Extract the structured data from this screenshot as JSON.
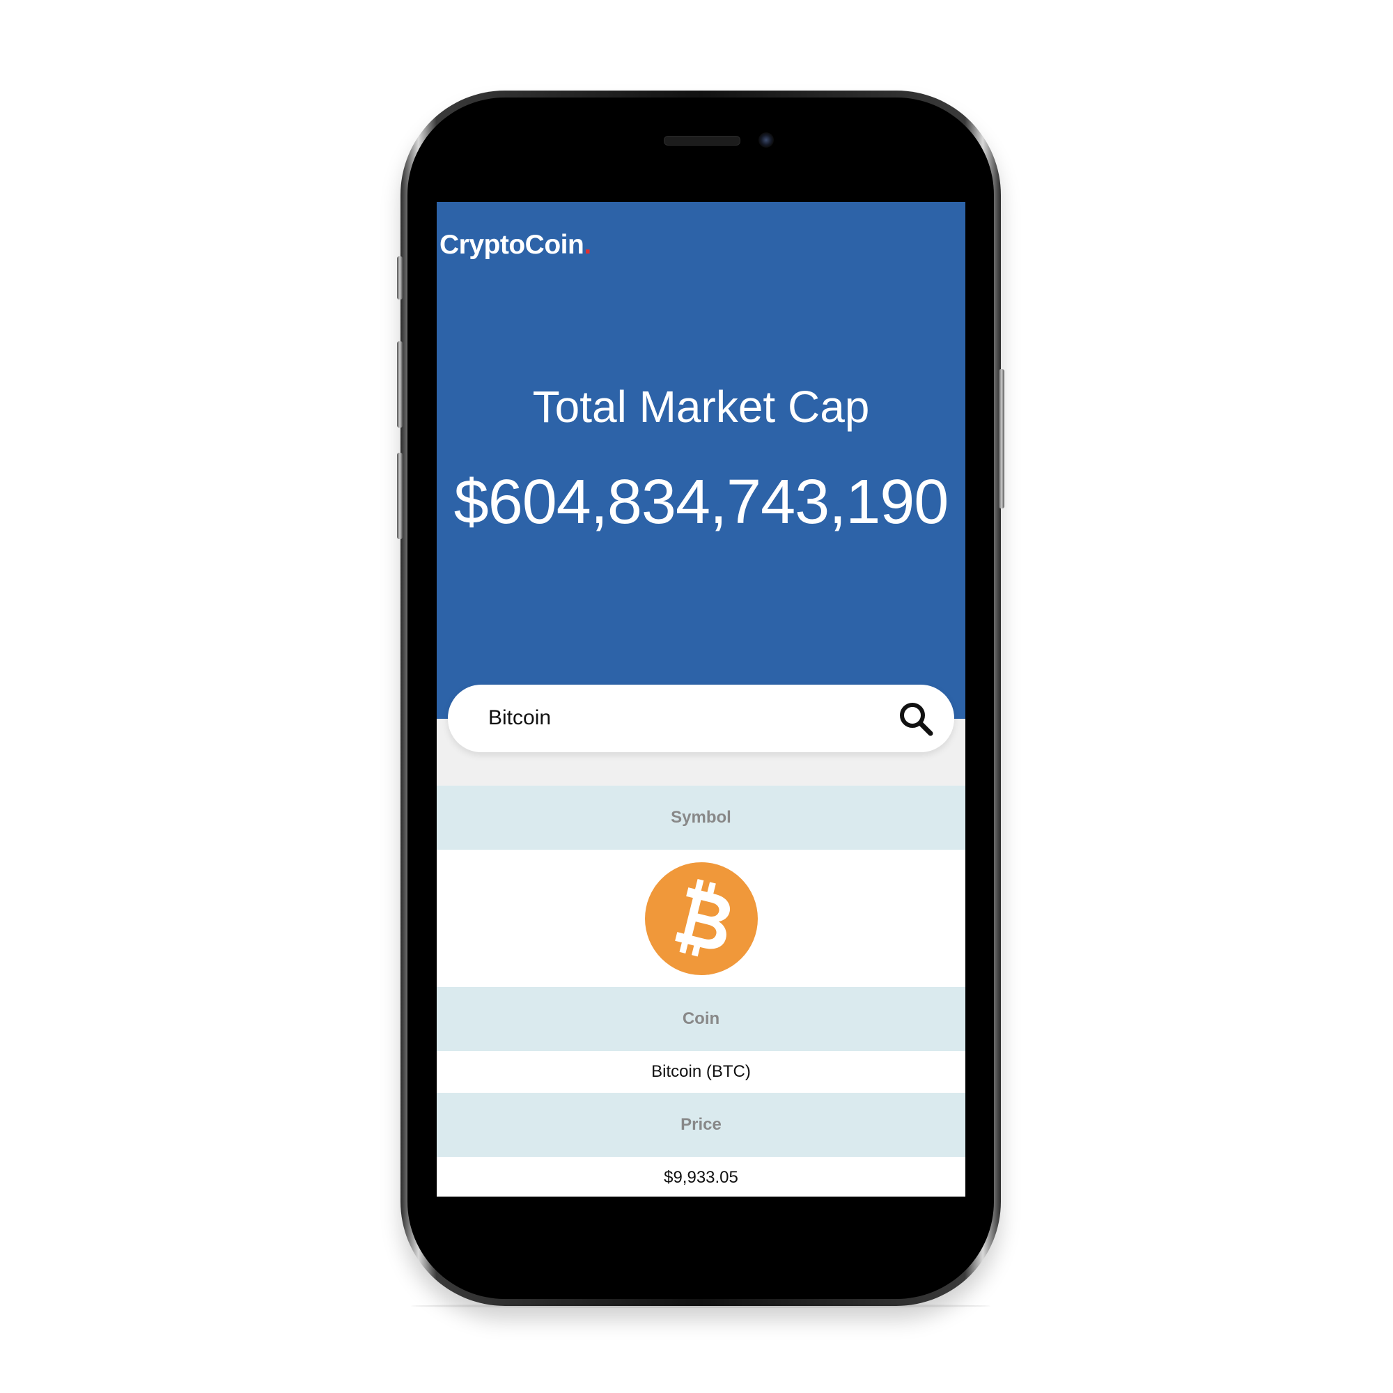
{
  "app": {
    "logo_text": "CryptoCoin",
    "logo_dot": ".",
    "colors": {
      "hero_bg": "#2d63a8",
      "logo_dot": "#e03030",
      "table_header_bg": "#daeaee",
      "bitcoin_orange": "#f0983a"
    }
  },
  "hero": {
    "title": "Total Market Cap",
    "value": "$604,834,743,190"
  },
  "search": {
    "value": "Bitcoin",
    "icon": "search-icon"
  },
  "table": {
    "symbol_header": "Symbol",
    "symbol_icon": "bitcoin-icon",
    "coin_header": "Coin",
    "coin_value": "Bitcoin (BTC)",
    "price_header": "Price",
    "price_value": "$9,933.05"
  }
}
